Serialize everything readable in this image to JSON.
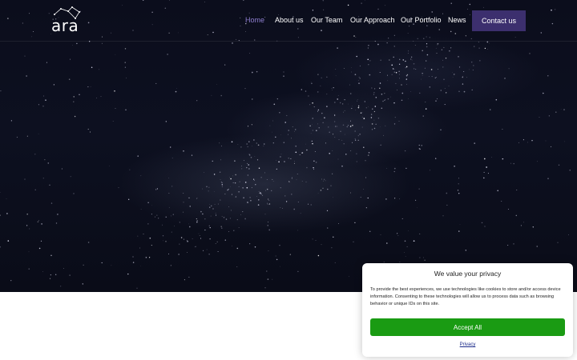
{
  "logo": {
    "text": "ara"
  },
  "nav": {
    "items": [
      {
        "label": "Home",
        "active": true
      },
      {
        "label": "About us"
      },
      {
        "label": "Our Team"
      },
      {
        "label": "Our Approach"
      },
      {
        "label": "Our Portfolio"
      },
      {
        "label": "News"
      }
    ],
    "cta_label": "Contact us"
  },
  "consent": {
    "title": "We value your privacy",
    "body": "To provide the best experiences, we use technologies like cookies to store and/or access device information. Consenting to these technologies will allow us to process data such as browsing behavior or unique IDs on this site.",
    "accept_label": "Accept All",
    "privacy_label": "Privacy"
  },
  "colors": {
    "nav_active": "#8f7fd0",
    "cta_background": "#3c2f6e",
    "accept_background": "#1a9b13",
    "hero_background": "#0b0d1c"
  }
}
